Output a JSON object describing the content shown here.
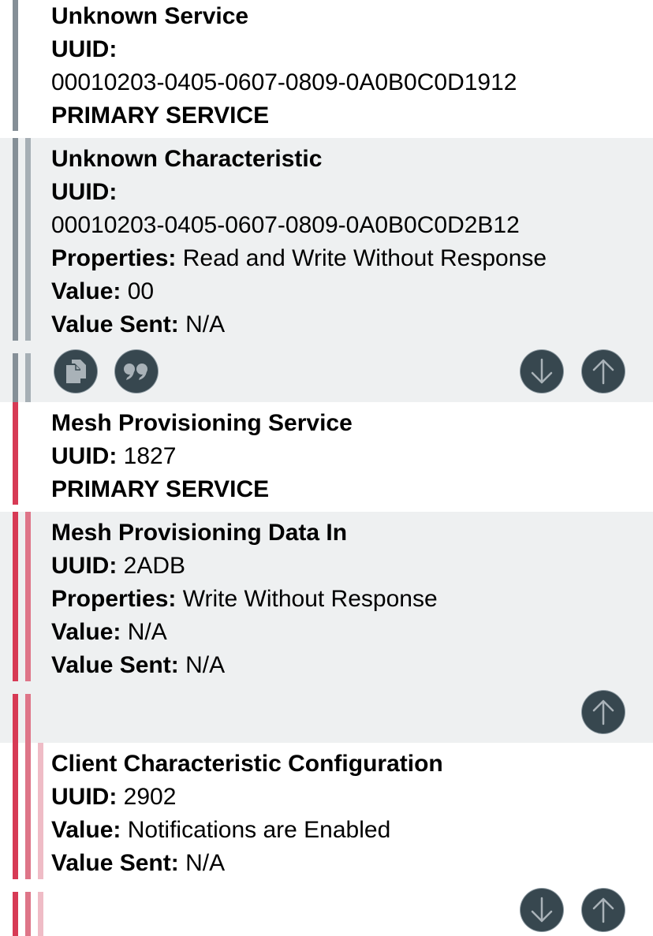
{
  "colors": {
    "gray_bar": "#858f97",
    "gray_bar_light": "#a6afb5",
    "red_bar": "#d73a55",
    "red_bar_mid": "#de7588",
    "red_bar_light": "#efbcc6",
    "panel_bg": "#eef0f1",
    "button_bg": "#37474f"
  },
  "services": [
    {
      "name": "Unknown Service",
      "uuid_label": "UUID:",
      "uuid": "00010203-0405-0607-0809-0A0B0C0D1912",
      "type": "PRIMARY SERVICE"
    },
    {
      "name": "Mesh Provisioning Service",
      "uuid_label": "UUID:",
      "uuid": "1827",
      "type": "PRIMARY SERVICE"
    }
  ],
  "characteristics": [
    {
      "name": "Unknown Characteristic",
      "uuid_label": "UUID:",
      "uuid": "00010203-0405-0607-0809-0A0B0C0D2B12",
      "properties_label": "Properties:",
      "properties": "Read and Write Without Response",
      "value_label": "Value:",
      "value": "00",
      "value_sent_label": "Value Sent:",
      "value_sent": "N/A",
      "actions": [
        "copy-icon",
        "quote-icon",
        "arrow-down-icon",
        "arrow-up-icon"
      ]
    },
    {
      "name": "Mesh Provisioning Data In",
      "uuid_label": "UUID:",
      "uuid": "2ADB",
      "properties_label": "Properties:",
      "properties": "Write Without Response",
      "value_label": "Value:",
      "value": "N/A",
      "value_sent_label": "Value Sent:",
      "value_sent": "N/A",
      "actions": [
        "arrow-up-icon"
      ]
    }
  ],
  "descriptors": [
    {
      "name": "Client Characteristic Configuration",
      "uuid_label": "UUID:",
      "uuid": "2902",
      "value_label": "Value:",
      "value": "Notifications are Enabled",
      "value_sent_label": "Value Sent:",
      "value_sent": "N/A",
      "actions": [
        "arrow-down-icon",
        "arrow-up-icon"
      ]
    }
  ]
}
